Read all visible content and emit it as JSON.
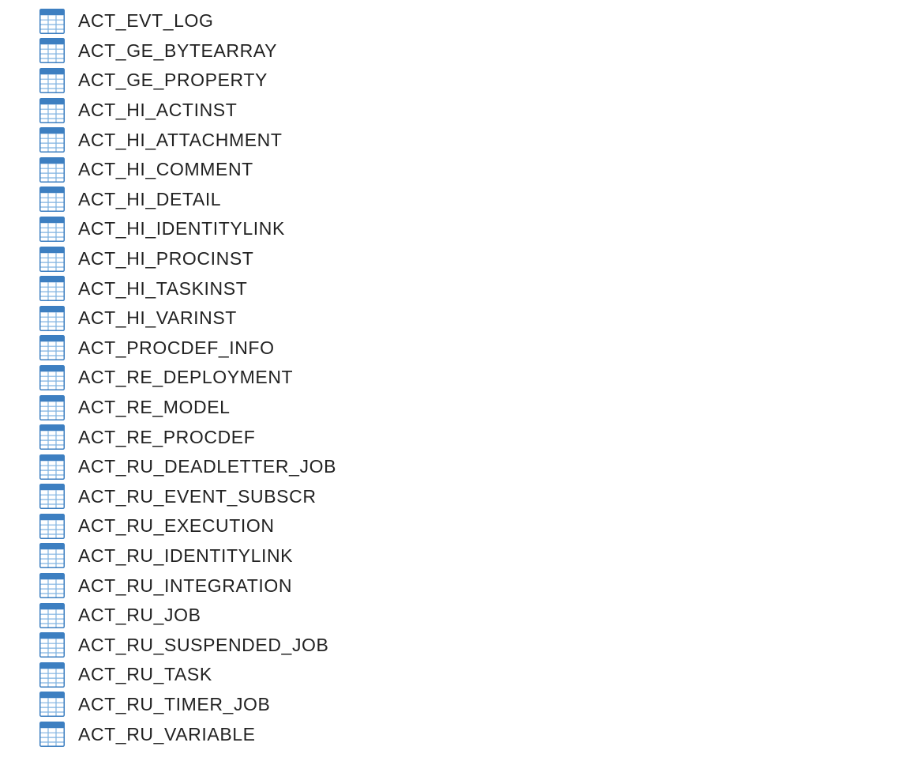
{
  "colors": {
    "icon_header": "#3d7fc1",
    "icon_border": "#3d7fc1",
    "icon_grid": "#7fb2e0",
    "text": "#222222",
    "background": "#ffffff"
  },
  "tables": [
    {
      "name": "ACT_EVT_LOG",
      "icon": "table-icon"
    },
    {
      "name": "ACT_GE_BYTEARRAY",
      "icon": "table-icon"
    },
    {
      "name": "ACT_GE_PROPERTY",
      "icon": "table-icon"
    },
    {
      "name": "ACT_HI_ACTINST",
      "icon": "table-icon"
    },
    {
      "name": "ACT_HI_ATTACHMENT",
      "icon": "table-icon"
    },
    {
      "name": "ACT_HI_COMMENT",
      "icon": "table-icon"
    },
    {
      "name": "ACT_HI_DETAIL",
      "icon": "table-icon"
    },
    {
      "name": "ACT_HI_IDENTITYLINK",
      "icon": "table-icon"
    },
    {
      "name": "ACT_HI_PROCINST",
      "icon": "table-icon"
    },
    {
      "name": "ACT_HI_TASKINST",
      "icon": "table-icon"
    },
    {
      "name": "ACT_HI_VARINST",
      "icon": "table-icon"
    },
    {
      "name": "ACT_PROCDEF_INFO",
      "icon": "table-icon"
    },
    {
      "name": "ACT_RE_DEPLOYMENT",
      "icon": "table-icon"
    },
    {
      "name": "ACT_RE_MODEL",
      "icon": "table-icon"
    },
    {
      "name": "ACT_RE_PROCDEF",
      "icon": "table-icon"
    },
    {
      "name": "ACT_RU_DEADLETTER_JOB",
      "icon": "table-icon"
    },
    {
      "name": "ACT_RU_EVENT_SUBSCR",
      "icon": "table-icon"
    },
    {
      "name": "ACT_RU_EXECUTION",
      "icon": "table-icon"
    },
    {
      "name": "ACT_RU_IDENTITYLINK",
      "icon": "table-icon"
    },
    {
      "name": "ACT_RU_INTEGRATION",
      "icon": "table-icon"
    },
    {
      "name": "ACT_RU_JOB",
      "icon": "table-icon"
    },
    {
      "name": "ACT_RU_SUSPENDED_JOB",
      "icon": "table-icon"
    },
    {
      "name": "ACT_RU_TASK",
      "icon": "table-icon"
    },
    {
      "name": "ACT_RU_TIMER_JOB",
      "icon": "table-icon"
    },
    {
      "name": "ACT_RU_VARIABLE",
      "icon": "table-icon"
    }
  ]
}
